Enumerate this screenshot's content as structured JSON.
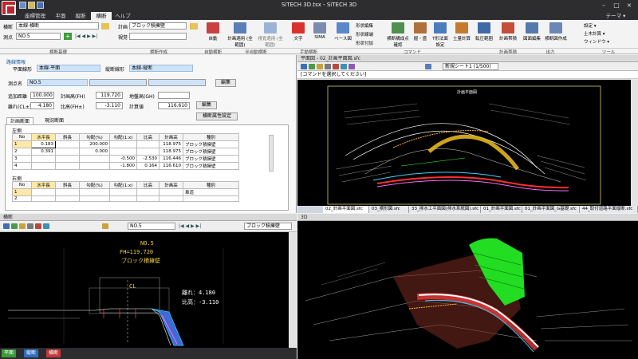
{
  "window": {
    "title": "SiTECH 3D.tsx - SiTECH 3D",
    "theme_label": "テーマ ▾"
  },
  "menu": [
    "座標管理",
    "平面",
    "縦断",
    "横断",
    "ヘルプ"
  ],
  "ribbon": {
    "fields": {
      "row1_label": "横断",
      "row1_value": "本線-横断",
      "row2_label": "測点",
      "row2_value": "NO.5",
      "row3_label": "計画",
      "row3_value": "ブロック積擁壁",
      "row4_label": "視覚"
    },
    "buttons": [
      "自動",
      "計画適用\n(全範囲)",
      "視覚適用\n(全範囲)",
      "文字",
      "SIMA",
      "ベース図",
      "形状編集",
      "形状線端",
      "形状付加",
      "横断構成点\n確認",
      "掘・盛",
      "T形法面\n設定",
      "土量計算",
      "転圧範囲",
      "計画帯積",
      "図面編集",
      "横断図作成"
    ],
    "right_items": [
      "設定 ▾",
      "土木計算 ▾",
      "ウィンドウ ▾"
    ],
    "groups": [
      "横断基礎",
      "横断作成",
      "自動横断",
      "半自動横断",
      "手動横断",
      "コマンド",
      "計画帯積",
      "出力",
      "ツール"
    ]
  },
  "route_panel": {
    "header": "路線情報",
    "plan_label": "平面線形",
    "plan_value": "本線-平面",
    "profile_label": "縦断線形",
    "profile_value": "本線-縦断",
    "station_label": "測点名",
    "station_value": "NO.5",
    "edit1": "編集",
    "add_dist_label": "追加距離",
    "add_dist": "100.000",
    "plan_h_label": "計画高(FH)",
    "plan_h": "119.720",
    "ground_h_label": "地盤高(GH)",
    "ground_h": "",
    "sep_label": "離れ(CL±)",
    "sep": "4.180",
    "ratio_label": "比高(FH±)",
    "ratio": "-3.110",
    "plan_val_label": "計算値",
    "plan_val": "116.610",
    "edit2": "編集",
    "attr_btn": "横断属性設定"
  },
  "tabs": {
    "plan": "計画断面",
    "current": "現況断面"
  },
  "left_table": {
    "title": "左側",
    "headers": [
      "No",
      "水平長",
      "斜長",
      "勾配(%)",
      "勾配(1:x)",
      "比高",
      "計画高",
      "種別"
    ],
    "rows": [
      [
        "1",
        "0.183",
        "",
        "200.000",
        "",
        "",
        "118.975",
        "ブロック積擁壁"
      ],
      [
        "2",
        "0.391",
        "",
        "0.000",
        "",
        "",
        "118.975",
        "ブロック積擁壁"
      ],
      [
        "3",
        "",
        "",
        "",
        "-0.500",
        "-2.530",
        "116.446",
        "ブロック積擁壁"
      ],
      [
        "4",
        "",
        "",
        "",
        "-1.800",
        "0.164",
        "116.610",
        "ブロック積擁壁"
      ]
    ]
  },
  "right_table": {
    "title": "右側",
    "headers": [
      "No",
      "水平長",
      "斜長",
      "勾配(%)",
      "勾配(1:x)",
      "比高",
      "計画高",
      "種別"
    ],
    "rows": [
      [
        "1",
        "",
        "",
        "",
        "",
        "",
        "",
        "車道"
      ],
      [
        "2",
        "",
        "",
        "",
        "",
        "",
        "",
        ""
      ]
    ]
  },
  "plan_view": {
    "title": "平面図 - 02_計画平面図.sfc",
    "sheet": "新規シート1 (1/500)",
    "prompt": "[コマンドを選択してください]",
    "drawing_title": "計画平面図",
    "tabs": [
      "02_計画平面図.sfc",
      "03_横形図.sfc",
      "33_排水工平面図(排水系統図).sfc",
      "01_計画平面図.sfc",
      "01_計画平面図_G基礎.sfc",
      "44_取付道路平面縦断.sfc"
    ]
  },
  "cross_view": {
    "title": "横断",
    "station": "NO.5",
    "type": "ブロック積擁壁",
    "station_text": "NO.5",
    "fh_text": "FH=119.720",
    "type_text": "ブロック積擁壁",
    "dist_text": "離れ：4.180",
    "ratio_text": "比高：-3.110",
    "cl_text": "CL"
  },
  "view3d": {
    "title": "3D"
  },
  "bottom_tabs": [
    "平面",
    "縦断",
    "横断"
  ]
}
